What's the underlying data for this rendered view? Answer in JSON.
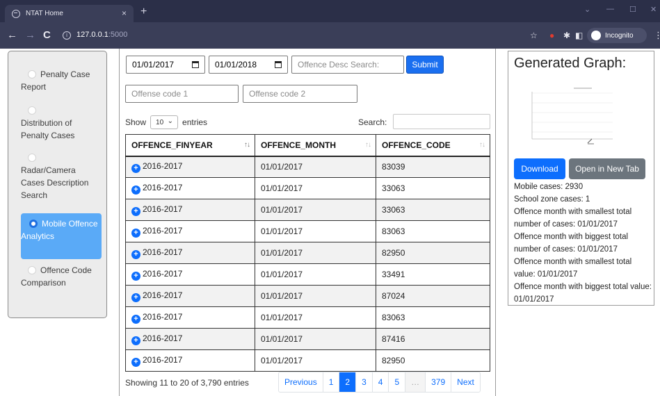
{
  "browser": {
    "tab_title": "NTAT Home",
    "tab_close": "×",
    "new_tab": "+",
    "url_host": "127.0.0.1",
    "url_port": ":5000",
    "incognito_label": "Incognito"
  },
  "sidebar": {
    "items": [
      {
        "label": "Penalty Case Report",
        "active": false
      },
      {
        "label": "Distribution of Penalty Cases",
        "active": false
      },
      {
        "label": "Radar/Camera Cases Description Search",
        "active": false
      },
      {
        "label": "Mobile Offence Analytics",
        "active": true
      },
      {
        "label": "Offence Code Comparison",
        "active": false
      }
    ]
  },
  "filters": {
    "start_date": "01/01/2017",
    "end_date": "01/01/2018",
    "desc_search_placeholder": "Offence Desc Search:",
    "submit_label": "Submit",
    "code1_placeholder": "Offense code 1",
    "code2_placeholder": "Offense code 2"
  },
  "table_controls": {
    "show_label": "Show",
    "page_length": "10",
    "entries_label": "entries",
    "search_label": "Search:"
  },
  "table": {
    "headers": [
      "OFFENCE_FINYEAR",
      "OFFENCE_MONTH",
      "OFFENCE_CODE"
    ],
    "rows": [
      [
        "2016-2017",
        "01/01/2017",
        "83039"
      ],
      [
        "2016-2017",
        "01/01/2017",
        "33063"
      ],
      [
        "2016-2017",
        "01/01/2017",
        "33063"
      ],
      [
        "2016-2017",
        "01/01/2017",
        "83063"
      ],
      [
        "2016-2017",
        "01/01/2017",
        "82950"
      ],
      [
        "2016-2017",
        "01/01/2017",
        "33491"
      ],
      [
        "2016-2017",
        "01/01/2017",
        "87024"
      ],
      [
        "2016-2017",
        "01/01/2017",
        "83063"
      ],
      [
        "2016-2017",
        "01/01/2017",
        "87416"
      ],
      [
        "2016-2017",
        "01/01/2017",
        "82950"
      ]
    ],
    "info": "Showing 11 to 20 of 3,790 entries"
  },
  "pagination": {
    "previous": "Previous",
    "pages": [
      "1",
      "2",
      "3",
      "4",
      "5",
      "…",
      "379"
    ],
    "current": "2",
    "next": "Next"
  },
  "graph_panel": {
    "title": "Generated Graph:",
    "download_label": "Download",
    "open_label": "Open in New Tab",
    "stats": [
      "Mobile cases: 2930",
      "School zone cases: 1",
      "Offence month with smallest total number of cases: 01/01/2017",
      "Offence month with biggest total number of cases: 01/01/2017",
      "Offence month with smallest total value: 01/01/2017",
      "Offence month with biggest total value: 01/01/2017"
    ]
  },
  "colors": {
    "primary": "#0d6efd",
    "active_nav": "#5aaaf7",
    "secondary_button": "#6c757d",
    "browser_chrome": "#2b2f48"
  }
}
